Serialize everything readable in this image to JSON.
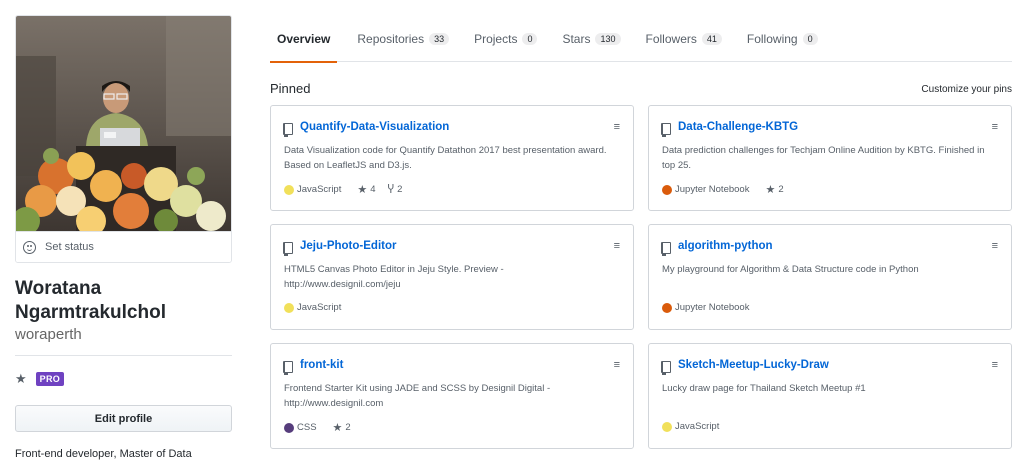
{
  "profile": {
    "set_status": "Set status",
    "fullname": "Woratana Ngarmtrakulchol",
    "username": "woraperth",
    "badge": "PRO",
    "edit_profile": "Edit profile",
    "bio": "Front-end developer, Master of Data"
  },
  "tabs": [
    {
      "label": "Overview",
      "count": ""
    },
    {
      "label": "Repositories",
      "count": "33"
    },
    {
      "label": "Projects",
      "count": "0"
    },
    {
      "label": "Stars",
      "count": "130"
    },
    {
      "label": "Followers",
      "count": "41"
    },
    {
      "label": "Following",
      "count": "0"
    }
  ],
  "pinned": {
    "title": "Pinned",
    "customize": "Customize your pins",
    "repos": [
      {
        "name": "Quantify-Data-Visualization",
        "desc": "Data Visualization code for Quantify Datathon 2017 best presentation award. Based on LeafletJS and D3.js.",
        "language": "JavaScript",
        "lang_color": "#f1e05a",
        "stars": "4",
        "forks": "2"
      },
      {
        "name": "Data-Challenge-KBTG",
        "desc": "Data prediction challenges for Techjam Online Audition by KBTG. Finished in top 25.",
        "language": "Jupyter Notebook",
        "lang_color": "#DA5B0B",
        "stars": "2",
        "forks": ""
      },
      {
        "name": "Jeju-Photo-Editor",
        "desc": "HTML5 Canvas Photo Editor in Jeju Style. Preview - http://www.designil.com/jeju",
        "language": "JavaScript",
        "lang_color": "#f1e05a",
        "stars": "",
        "forks": ""
      },
      {
        "name": "algorithm-python",
        "desc": "My playground for Algorithm & Data Structure code in Python",
        "language": "Jupyter Notebook",
        "lang_color": "#DA5B0B",
        "stars": "",
        "forks": ""
      },
      {
        "name": "front-kit",
        "desc": "Frontend Starter Kit using JADE and SCSS by Designil Digital - http://www.designil.com",
        "language": "CSS",
        "lang_color": "#563d7c",
        "stars": "2",
        "forks": ""
      },
      {
        "name": "Sketch-Meetup-Lucky-Draw",
        "desc": "Lucky draw page for Thailand Sketch Meetup #1",
        "language": "JavaScript",
        "lang_color": "#f1e05a",
        "stars": "",
        "forks": ""
      }
    ]
  },
  "colors": {
    "accent_tab": "#e36209",
    "link": "#0366d6",
    "pro_badge": "#6f42c1"
  },
  "icons": {
    "status": "smiley-icon",
    "pro_star": "star-icon",
    "repo": "repo-icon",
    "drag": "grabber-icon",
    "fork": "fork-icon"
  }
}
